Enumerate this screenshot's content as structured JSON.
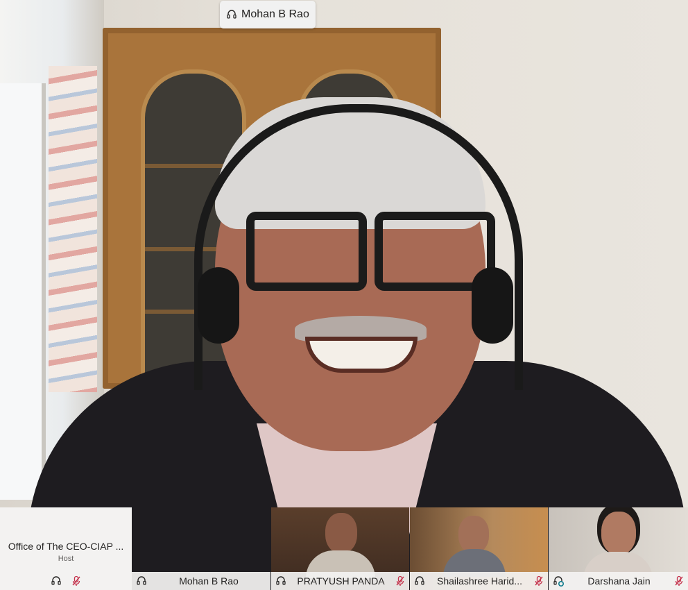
{
  "active_speaker": {
    "name": "Mohan B Rao",
    "icon": "headset-icon"
  },
  "host_tile": {
    "name": "Office of The CEO-CIAP ...",
    "role": "Host",
    "icons": [
      "headset-icon",
      "mic-muted-icon"
    ]
  },
  "participants": [
    {
      "name": "Mohan B Rao",
      "icon": "headset-icon",
      "muted": false
    },
    {
      "name": "PRATYUSH PANDA",
      "icon": "headset-icon",
      "muted": true
    },
    {
      "name": "Shailashree Harid...",
      "icon": "headset-icon",
      "muted": true
    },
    {
      "name": "Darshana Jain",
      "icon": "headset-speaking-icon",
      "muted": true
    }
  ],
  "colors": {
    "mute_red": "#c4314b",
    "label_bg": "#f3f2f1",
    "speaking_teal": "#0f7b8c"
  }
}
